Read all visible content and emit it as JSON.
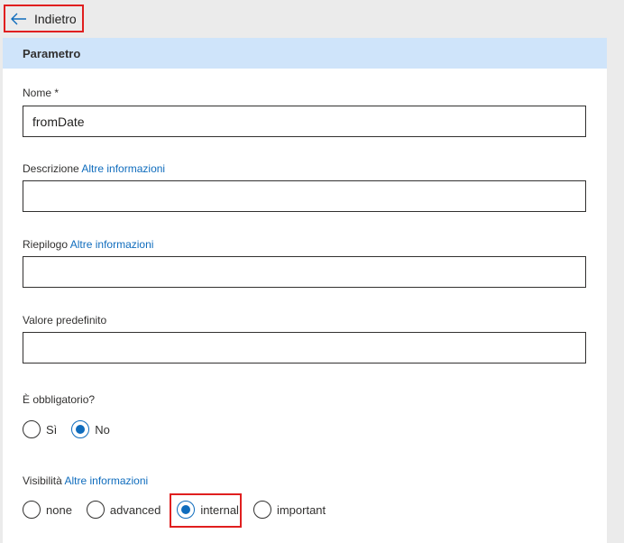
{
  "nav": {
    "back_label": "Indietro",
    "back_icon": "arrow-left-icon"
  },
  "panel": {
    "title": "Parametro"
  },
  "form": {
    "name": {
      "label": "Nome *",
      "value": "fromDate"
    },
    "description": {
      "label": "Descrizione",
      "link": "Altre informazioni",
      "value": ""
    },
    "summary": {
      "label": "Riepilogo",
      "link": "Altre informazioni",
      "value": ""
    },
    "default_value": {
      "label": "Valore predefinito",
      "value": ""
    },
    "required": {
      "label": "È obbligatorio?",
      "options": [
        "Sì",
        "No"
      ],
      "selected": "No"
    },
    "visibility": {
      "label": "Visibilità",
      "link": "Altre informazioni",
      "options": [
        "none",
        "advanced",
        "internal",
        "important"
      ],
      "selected": "internal"
    }
  },
  "colors": {
    "accent": "#0f6cbd",
    "header_bg": "#cfe4fa",
    "highlight": "#e01f1f",
    "page_bg": "#ebebeb"
  }
}
